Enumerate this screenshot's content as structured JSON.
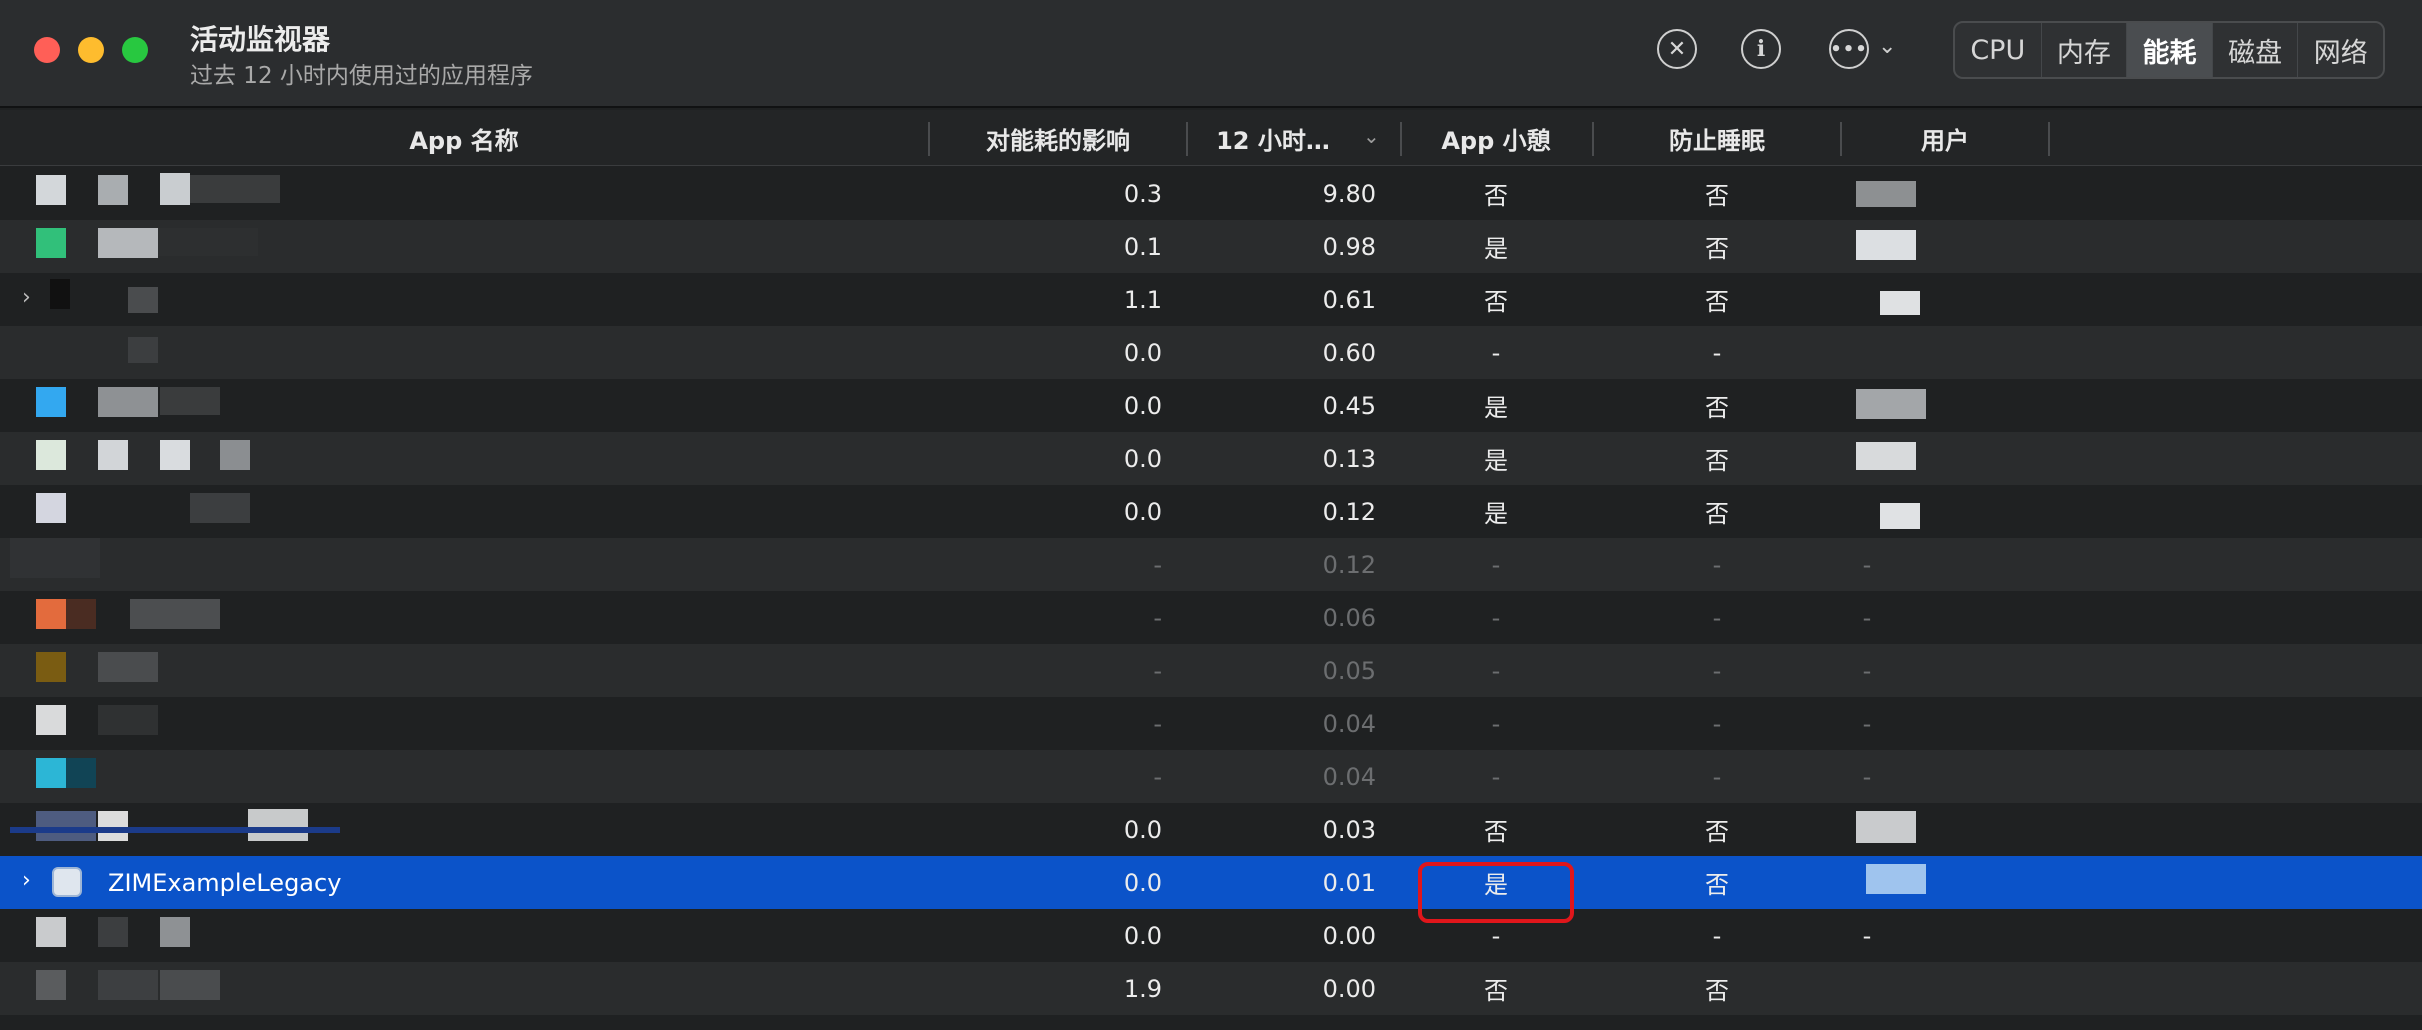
{
  "window": {
    "title": "活动监视器",
    "subtitle": "过去 12 小时内使用过的应用程序"
  },
  "toolbar": {
    "stop_icon": "xmark-circle-icon",
    "info_icon": "info-circle-icon",
    "more_icon": "ellipsis-circle-icon",
    "tabs": [
      {
        "label": "CPU",
        "active": false
      },
      {
        "label": "内存",
        "active": false
      },
      {
        "label": "能耗",
        "active": true
      },
      {
        "label": "磁盘",
        "active": false
      },
      {
        "label": "网络",
        "active": false
      }
    ]
  },
  "columns": {
    "app_name": "App 名称",
    "energy_impact": "对能耗的影响",
    "twelve_hr": "12 小时…",
    "app_nap": "App 小憩",
    "prevent_sleep": "防止睡眠",
    "user": "用户"
  },
  "rows": [
    {
      "name": "",
      "impact": "0.3",
      "twelve": "9.80",
      "nap": "否",
      "sleep": "否",
      "user": "",
      "dim": false,
      "selected": false
    },
    {
      "name": "",
      "impact": "0.1",
      "twelve": "0.98",
      "nap": "是",
      "sleep": "否",
      "user": "",
      "dim": false,
      "selected": false
    },
    {
      "name": "",
      "impact": "1.1",
      "twelve": "0.61",
      "nap": "否",
      "sleep": "否",
      "user": "",
      "dim": false,
      "selected": false
    },
    {
      "name": "",
      "impact": "0.0",
      "twelve": "0.60",
      "nap": "-",
      "sleep": "-",
      "user": "",
      "dim": false,
      "selected": false
    },
    {
      "name": "",
      "impact": "0.0",
      "twelve": "0.45",
      "nap": "是",
      "sleep": "否",
      "user": "",
      "dim": false,
      "selected": false
    },
    {
      "name": "",
      "impact": "0.0",
      "twelve": "0.13",
      "nap": "是",
      "sleep": "否",
      "user": "",
      "dim": false,
      "selected": false
    },
    {
      "name": "",
      "impact": "0.0",
      "twelve": "0.12",
      "nap": "是",
      "sleep": "否",
      "user": "",
      "dim": false,
      "selected": false
    },
    {
      "name": "",
      "impact": "-",
      "twelve": "0.12",
      "nap": "-",
      "sleep": "-",
      "user": "-",
      "dim": true,
      "selected": false
    },
    {
      "name": "",
      "impact": "-",
      "twelve": "0.06",
      "nap": "-",
      "sleep": "-",
      "user": "-",
      "dim": true,
      "selected": false
    },
    {
      "name": "",
      "impact": "-",
      "twelve": "0.05",
      "nap": "-",
      "sleep": "-",
      "user": "-",
      "dim": true,
      "selected": false
    },
    {
      "name": "",
      "impact": "-",
      "twelve": "0.04",
      "nap": "-",
      "sleep": "-",
      "user": "-",
      "dim": true,
      "selected": false
    },
    {
      "name": "",
      "impact": "-",
      "twelve": "0.04",
      "nap": "-",
      "sleep": "-",
      "user": "-",
      "dim": true,
      "selected": false
    },
    {
      "name": "",
      "impact": "0.0",
      "twelve": "0.03",
      "nap": "否",
      "sleep": "否",
      "user": "",
      "dim": false,
      "selected": false
    },
    {
      "name": "ZIMExampleLegacy",
      "impact": "0.0",
      "twelve": "0.01",
      "nap": "是",
      "sleep": "否",
      "user": "",
      "dim": false,
      "selected": true
    },
    {
      "name": "",
      "impact": "0.0",
      "twelve": "0.00",
      "nap": "-",
      "sleep": "-",
      "user": "-",
      "dim": false,
      "selected": false
    },
    {
      "name": "",
      "impact": "1.9",
      "twelve": "0.00",
      "nap": "否",
      "sleep": "否",
      "user": "",
      "dim": false,
      "selected": false
    }
  ],
  "colors": {
    "selection": "#0b53c9",
    "highlight_box": "#e0161b",
    "background": "#1f2122"
  }
}
